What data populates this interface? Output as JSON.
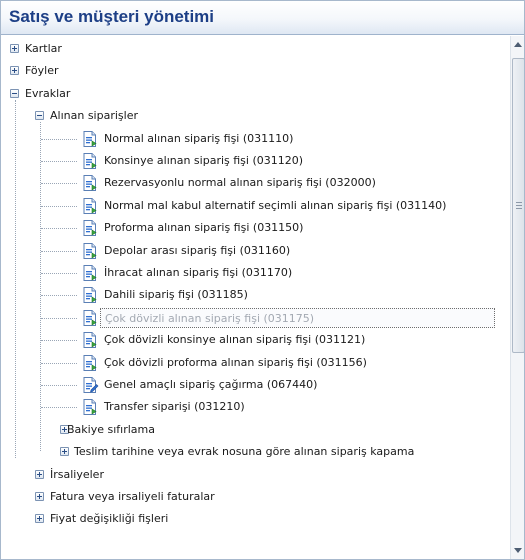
{
  "panel": {
    "title": "Satış ve müşteri yönetimi"
  },
  "tree": {
    "top": [
      {
        "label": "Kartlar",
        "state": "collapsed"
      },
      {
        "label": "Föyler",
        "state": "collapsed"
      },
      {
        "label": "Evraklar",
        "state": "expanded"
      }
    ],
    "group": {
      "label": "Alınan siparişler",
      "state": "expanded"
    },
    "documents": [
      "Normal alınan sipariş fişi (031110)",
      "Konsinye alınan sipariş fişi (031120)",
      "Rezervasyonlu normal alınan sipariş fişi (032000)",
      "Normal mal kabul alternatif seçimli alınan sipariş fişi (031140)",
      "Proforma alınan sipariş fişi (031150)",
      "Depolar arası sipariş fişi (031160)",
      "İhracat alınan sipariş fişi (031170)",
      "Dahili sipariş fişi (031185)",
      "Çok dövizli alınan sipariş fişi (031175)",
      "Çok dövizli konsinye alınan sipariş fişi (031121)",
      "Çok dövizli proforma alınan sipariş fişi (031156)",
      "Genel amaçlı sipariş çağırma (067440)",
      "Transfer siparişi (031210)"
    ],
    "selected_index": 8,
    "sub_groups": [
      {
        "label": "Bakiye sıfırlama",
        "state": "collapsed"
      },
      {
        "label": "Teslim tarihine veya evrak nosuna göre alınan sipariş kapama",
        "state": "collapsed"
      }
    ],
    "bottom": [
      {
        "label": "İrsaliyeler",
        "state": "collapsed"
      },
      {
        "label": "Fatura veya irsaliyeli faturalar",
        "state": "collapsed"
      },
      {
        "label": "Fiyat değişikliği fişleri",
        "state": "collapsed"
      }
    ]
  },
  "colors": {
    "title": "#1d3f86",
    "icon_blue": "#2f6fd1",
    "icon_green": "#3aa640"
  }
}
